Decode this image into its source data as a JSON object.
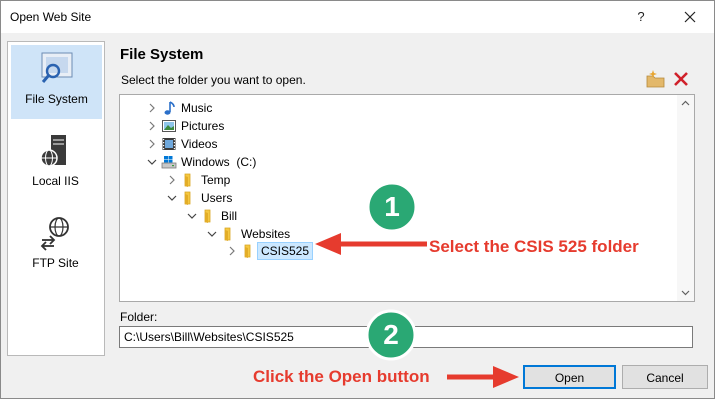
{
  "window": {
    "title": "Open Web Site",
    "help_label": "?"
  },
  "sidebar": {
    "items": [
      {
        "label": "File System",
        "icon": "file-system-icon",
        "selected": true
      },
      {
        "label": "Local IIS",
        "icon": "server-icon",
        "selected": false
      },
      {
        "label": "FTP Site",
        "icon": "globe-transfer-icon",
        "selected": false
      }
    ]
  },
  "main": {
    "heading": "File System",
    "instruction": "Select the folder you want to open.",
    "folder_label": "Folder:",
    "folder_value": "C:\\Users\\Bill\\Websites\\CSIS525"
  },
  "tree": {
    "nodes": [
      {
        "label": "Music",
        "icon": "music-icon",
        "expander": "collapsed",
        "selected": false
      },
      {
        "label": "Pictures",
        "icon": "pictures-icon",
        "expander": "collapsed",
        "selected": false
      },
      {
        "label": "Videos",
        "icon": "videos-icon",
        "expander": "collapsed",
        "selected": false
      },
      {
        "label": "Windows  (C:)",
        "icon": "drive-icon",
        "expander": "expanded",
        "selected": false
      },
      {
        "label": "Temp",
        "icon": "folder-icon",
        "expander": "collapsed",
        "selected": false
      },
      {
        "label": "Users",
        "icon": "folder-icon",
        "expander": "expanded",
        "selected": false
      },
      {
        "label": "Bill",
        "icon": "folder-icon",
        "expander": "expanded",
        "selected": false
      },
      {
        "label": "Websites",
        "icon": "folder-icon",
        "expander": "expanded",
        "selected": false
      },
      {
        "label": "CSIS525",
        "icon": "folder-icon",
        "expander": "collapsed",
        "selected": true
      }
    ]
  },
  "buttons": {
    "open": "Open",
    "cancel": "Cancel"
  },
  "annotations": {
    "step1_number": "1",
    "step1_text": "Select the CSIS 525 folder",
    "step2_number": "2",
    "step2_text": "Click the Open button"
  },
  "colors": {
    "accent": "#0078d7",
    "annotation_red": "#e63b2e",
    "badge_green": "#2aa874",
    "selection": "#cce8ff",
    "folder_yellow": "#f5c842"
  }
}
